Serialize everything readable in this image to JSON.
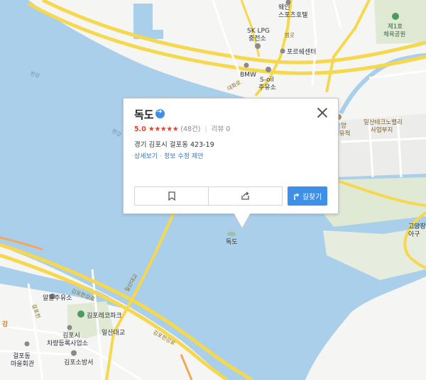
{
  "map": {
    "labels": {
      "weian_sports_hotel": "웨인\n스포츠호텔",
      "sk_lpg": "SK LPG\n충전소",
      "porsche_center": "포르쉐센터",
      "bmw": "BMW",
      "s_oil": "S-oil\n주유소",
      "no1_park": "제1호\n체육공원",
      "ilsan_techno": "일산테크노밸리\n사업부지",
      "historic_site": "양\n산유적",
      "goyang_jang": "고양장\n아구",
      "dokdo_map": "독도",
      "altteum_gas": "알뜰주유소",
      "gimpo_eco": "김포레코파크",
      "gimpo_registration": "김포시\n차량등록사업소",
      "ilsan_bridge": "일산대교",
      "gimpo_fire": "김포소방서",
      "geolpo_hall": "걸포동\n마을회관",
      "gimpo_expressway1": "김포한강로",
      "gimpo_expressway2": "김포한강로",
      "ilsan_daegyo_road": "일산대교",
      "daehwa_road": "대화로",
      "bridge_ramp_label": "범곳",
      "han_river_1": "한강",
      "han_river_2": "한강",
      "geolpo_road": "걸포천",
      "area_orange": "강"
    }
  },
  "popup": {
    "title": "독도",
    "rating": "5.0",
    "stars": "★★★★★",
    "rating_count": "(48건)",
    "review": "리뷰 0",
    "address": "경기 김포시 걸포동 423-19",
    "link_detail": "상세보기",
    "link_edit": "정보 수정 제안",
    "route_label": "길찾기"
  },
  "colors": {
    "water": "#a9cfeb",
    "land": "#f5f5f3",
    "park": "#dfe9d3",
    "road_yellow": "#f6d84e",
    "accent_blue": "#3d8fe8",
    "rating_red": "#e2432a"
  }
}
